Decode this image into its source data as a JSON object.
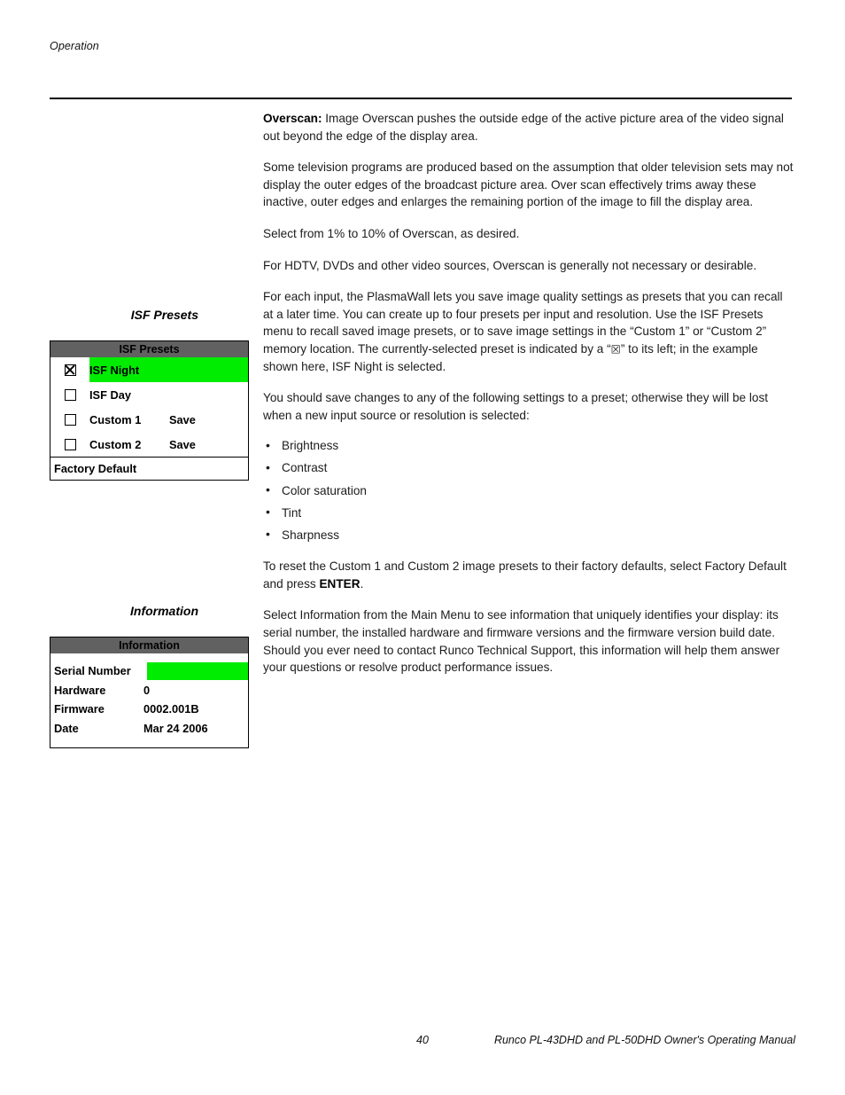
{
  "page": {
    "running_head": "Operation",
    "footer_page_number": "40",
    "footer_title": "Runco PL-43DHD and PL-50DHD Owner's Operating Manual"
  },
  "colors": {
    "osd_title_bar": "#616161",
    "osd_highlight_green": "#00ec00",
    "text": "#1c1c1c",
    "rule": "#000000"
  },
  "body": {
    "overscan": {
      "lead_bold": "Overscan:",
      "lead_rest": " Image Overscan pushes the outside edge of the active picture area of the video signal out beyond the edge of the display area.",
      "para2": "Some television programs are produced based on the assumption that older television sets may not display the outer edges of the broadcast picture area. Over scan effectively trims away these inactive, outer edges and enlarges the remaining portion of the image to fill the display area.",
      "para3": "Select from 1% to 10% of Overscan, as desired.",
      "para4": "For HDTV, DVDs and other video sources, Overscan is generally not necessary or desirable."
    },
    "isf_presets": {
      "margin_heading": "ISF Presets",
      "para1_a": "For each input, the PlasmaWall lets you save image quality settings as presets that you can recall at a later time. You can create up to four presets per input and resolution. Use the ISF Presets menu to recall saved image presets, or to save image settings in the “Custom 1” or “Custom 2” memory location. The currently-selected preset is indicated by a “",
      "para1_glyph": "☒",
      "para1_b": "” to its left; in the example shown here, ISF Night is selected.",
      "para2": "You should save changes to any of the following settings to a preset; otherwise they will be lost when a new input source or resolution is selected:",
      "bullets": [
        "Brightness",
        "Contrast",
        "Color saturation",
        "Tint",
        "Sharpness"
      ],
      "reset_a": "To reset the Custom 1 and Custom 2 image presets to their factory defaults, select Factory Default and press ",
      "reset_bold": "ENTER",
      "reset_b": "."
    },
    "information": {
      "margin_heading": "Information",
      "para1": "Select Information from the Main Menu to see information that uniquely identifies your display: its serial number, the installed hardware and firmware versions and the firmware version build date. Should you ever need to contact Runco Technical Support, this information will help them answer your questions or resolve product performance issues."
    }
  },
  "osd_isf_presets": {
    "title": "ISF Presets",
    "rows": [
      {
        "label": "ISF Night",
        "checked": true,
        "highlighted": true,
        "save": ""
      },
      {
        "label": "ISF Day",
        "checked": false,
        "highlighted": false,
        "save": ""
      },
      {
        "label": "Custom 1",
        "checked": false,
        "highlighted": false,
        "save": "Save"
      },
      {
        "label": "Custom 2",
        "checked": false,
        "highlighted": false,
        "save": "Save"
      }
    ],
    "footer_item": "Factory Default"
  },
  "osd_information": {
    "title": "Information",
    "rows": [
      {
        "key": "Serial Number",
        "value": "",
        "highlighted": true
      },
      {
        "key": "Hardware",
        "value": "0",
        "highlighted": false
      },
      {
        "key": "Firmware",
        "value": "0002.001B",
        "highlighted": false
      },
      {
        "key": "Date",
        "value": "Mar 24 2006",
        "highlighted": false
      }
    ]
  }
}
